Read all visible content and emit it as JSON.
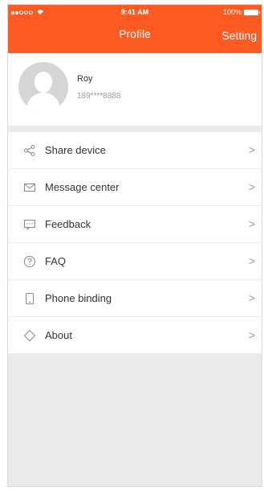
{
  "status_bar": {
    "carrier_dots": "●●○○○",
    "time": "9:41 AM",
    "battery": "100%"
  },
  "header": {
    "title": "Profile",
    "right_action": "Setting",
    "color": "#ff5a22"
  },
  "profile": {
    "name": "Roy",
    "phone": "189****8888"
  },
  "menu": {
    "items": [
      {
        "label": "Share device",
        "icon": "share-icon"
      },
      {
        "label": "Message center",
        "icon": "mail-icon"
      },
      {
        "label": "Feedback",
        "icon": "feedback-icon"
      },
      {
        "label": "FAQ",
        "icon": "question-icon"
      },
      {
        "label": "Phone binding",
        "icon": "phone-icon"
      },
      {
        "label": "About",
        "icon": "diamond-icon"
      }
    ],
    "chevron": ">"
  }
}
